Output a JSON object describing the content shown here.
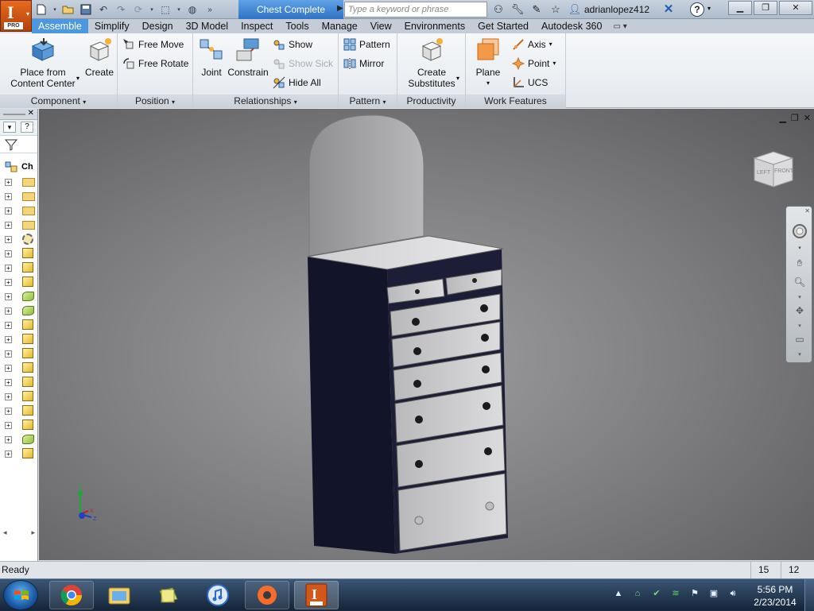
{
  "window": {
    "document_title": "Chest Complete",
    "search_placeholder": "Type a keyword or phrase",
    "username": "adrianlopez412",
    "app_badge": "PRO",
    "app_letter": "I"
  },
  "tabs": [
    "Assemble",
    "Simplify",
    "Design",
    "3D Model",
    "Inspect",
    "Tools",
    "Manage",
    "View",
    "Environments",
    "Get Started",
    "Autodesk 360"
  ],
  "active_tab": "Assemble",
  "ribbon": {
    "component": {
      "label": "Component",
      "place_from_content_center_line1": "Place from",
      "place_from_content_center_line2": "Content Center",
      "create": "Create"
    },
    "position": {
      "label": "Position",
      "free_move": "Free Move",
      "free_rotate": "Free Rotate"
    },
    "relationships": {
      "label": "Relationships",
      "joint": "Joint",
      "constrain": "Constrain",
      "show": "Show",
      "show_sick": "Show Sick",
      "hide_all": "Hide All"
    },
    "pattern": {
      "label": "Pattern",
      "pattern": "Pattern",
      "mirror": "Mirror"
    },
    "productivity": {
      "label": "Productivity",
      "create_substitutes_line1": "Create",
      "create_substitutes_line2": "Substitutes"
    },
    "work_features": {
      "label": "Work Features",
      "plane": "Plane",
      "axis": "Axis",
      "point": "Point",
      "ucs": "UCS"
    }
  },
  "browser": {
    "root_label": "Ch",
    "icon_types": [
      "assembly-icon",
      "folder-icon",
      "representations-icon",
      "folder-icon",
      "origin-icon",
      "part-icon",
      "part-icon",
      "part-icon",
      "joint-icon",
      "joint-icon",
      "part-icon",
      "part-icon",
      "part-icon",
      "part-icon",
      "part-icon",
      "part-icon",
      "part-icon",
      "part-icon",
      "joint-icon",
      "part-icon"
    ]
  },
  "viewcube": {
    "left_face": "LEFT",
    "front_face": "FRONT"
  },
  "statusbar": {
    "status": "Ready",
    "count1": "15",
    "count2": "12"
  },
  "taskbar": {
    "apps": [
      "chrome-icon",
      "file-explorer-icon",
      "sticky-notes-icon",
      "itunes-icon",
      "origin-icon",
      "autodesk-inventor-icon"
    ],
    "time": "5:56 PM",
    "date": "2/23/2014"
  },
  "colors": {
    "active_tab": "#4b97e0",
    "title_tab": "#3f86d6",
    "app_button": "#d4571a"
  }
}
